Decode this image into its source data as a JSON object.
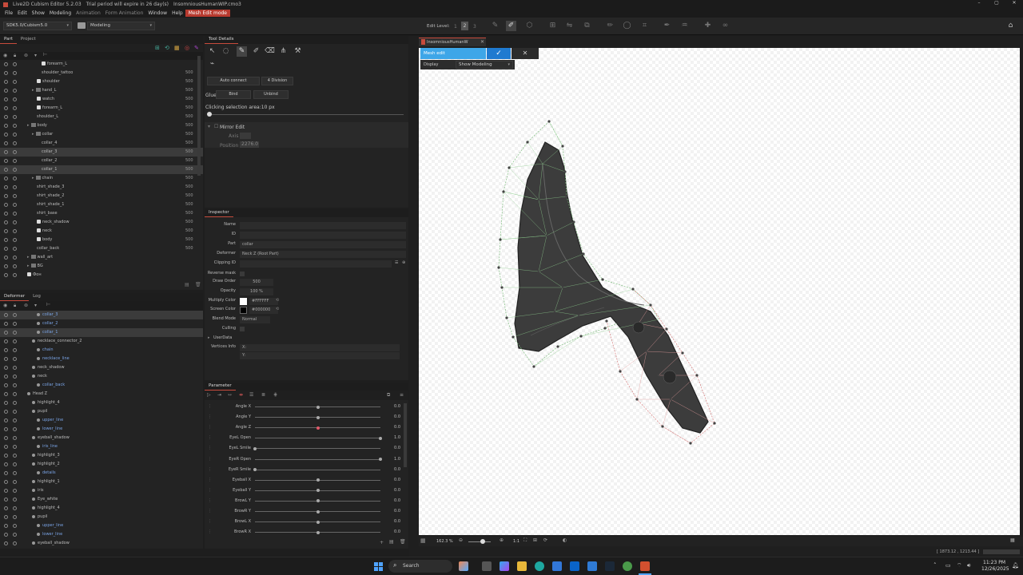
{
  "titlebar": {
    "app": "Live2D Cubism Editor 5.2.03",
    "trial": "Trial period will expire in 26 day(s)",
    "file": "InsomniousHumanWIP.cmo3"
  },
  "menu": [
    "File",
    "Edit",
    "Show",
    "Modeling",
    "Animation",
    "Form Animation",
    "Window",
    "Help"
  ],
  "menu_mode": "Mesh Edit mode",
  "toolbar": {
    "sdk": "SDK5.0/Cubism5.0",
    "workspace": "Modeling",
    "edit_level_label": "Edit Level:",
    "levels": [
      "1",
      "2",
      "3"
    ]
  },
  "part_panel": {
    "tabs": [
      "Part",
      "Project"
    ],
    "rows": [
      {
        "label": "forearm_L",
        "num": "",
        "indent": 52,
        "icon": "item"
      },
      {
        "label": "shoulder_tattoo",
        "num": "500",
        "indent": 52,
        "icon": "none"
      },
      {
        "label": "shoulder",
        "num": "500",
        "indent": 46,
        "icon": "item"
      },
      {
        "label": "hand_L",
        "num": "500",
        "indent": 40,
        "icon": "folder"
      },
      {
        "label": "watch",
        "num": "500",
        "indent": 46,
        "icon": "item"
      },
      {
        "label": "forearm_L",
        "num": "500",
        "indent": 46,
        "icon": "item"
      },
      {
        "label": "shoulder_L",
        "num": "500",
        "indent": 46,
        "icon": "none"
      },
      {
        "label": "body",
        "num": "500",
        "indent": 34,
        "icon": "folder"
      },
      {
        "label": "collar",
        "num": "500",
        "indent": 40,
        "icon": "folder"
      },
      {
        "label": "collar_4",
        "num": "500",
        "indent": 52,
        "icon": "none"
      },
      {
        "label": "collar_3",
        "num": "500",
        "indent": 52,
        "icon": "none",
        "sel": true
      },
      {
        "label": "collar_2",
        "num": "500",
        "indent": 52,
        "icon": "none"
      },
      {
        "label": "collar_1",
        "num": "500",
        "indent": 52,
        "icon": "none",
        "sel": true
      },
      {
        "label": "chain",
        "num": "500",
        "indent": 40,
        "icon": "folder"
      },
      {
        "label": "shirt_shade_3",
        "num": "500",
        "indent": 46,
        "icon": "none"
      },
      {
        "label": "shirt_shade_2",
        "num": "500",
        "indent": 46,
        "icon": "none"
      },
      {
        "label": "shirt_shade_1",
        "num": "500",
        "indent": 46,
        "icon": "none"
      },
      {
        "label": "shirt_base",
        "num": "500",
        "indent": 46,
        "icon": "none"
      },
      {
        "label": "neck_shadow",
        "num": "500",
        "indent": 46,
        "icon": "item"
      },
      {
        "label": "neck",
        "num": "500",
        "indent": 46,
        "icon": "item"
      },
      {
        "label": "body",
        "num": "500",
        "indent": 46,
        "icon": "item"
      },
      {
        "label": "collar_back",
        "num": "500",
        "indent": 46,
        "icon": "none"
      },
      {
        "label": "wall_art",
        "num": "",
        "indent": 34,
        "icon": "folder"
      },
      {
        "label": "BG",
        "num": "",
        "indent": 34,
        "icon": "folder"
      },
      {
        "label": "Фон",
        "num": "",
        "indent": 34,
        "icon": "item"
      }
    ]
  },
  "deformer_panel": {
    "tabs": [
      "Deformer",
      "Log"
    ],
    "rows": [
      {
        "label": "collar_3",
        "indent": 46,
        "sel": true
      },
      {
        "label": "collar_2",
        "indent": 46
      },
      {
        "label": "collar_1",
        "indent": 46,
        "sel": true
      },
      {
        "label": "necklace_connector_2",
        "indent": 40
      },
      {
        "label": "chain",
        "indent": 46
      },
      {
        "label": "necklace_line",
        "indent": 46
      },
      {
        "label": "neck_shadow",
        "indent": 40
      },
      {
        "label": "neck",
        "indent": 40
      },
      {
        "label": "collar_back",
        "indent": 46
      },
      {
        "label": "Head Z",
        "indent": 34
      },
      {
        "label": "highlight_4",
        "indent": 40
      },
      {
        "label": "pupil",
        "indent": 40
      },
      {
        "label": "upper_line",
        "indent": 46
      },
      {
        "label": "lower_line",
        "indent": 46
      },
      {
        "label": "eyeball_shadow",
        "indent": 40
      },
      {
        "label": "iris_line",
        "indent": 46
      },
      {
        "label": "highlight_3",
        "indent": 40
      },
      {
        "label": "highlight_2",
        "indent": 40
      },
      {
        "label": "details",
        "indent": 46
      },
      {
        "label": "highlight_1",
        "indent": 40
      },
      {
        "label": "iris",
        "indent": 40
      },
      {
        "label": "Eye_white",
        "indent": 40
      },
      {
        "label": "highlight_4",
        "indent": 40
      },
      {
        "label": "pupil",
        "indent": 40
      },
      {
        "label": "upper_line",
        "indent": 46
      },
      {
        "label": "lower_line",
        "indent": 46
      },
      {
        "label": "eyeball_shadow",
        "indent": 40
      }
    ]
  },
  "tool_details": {
    "title": "Tool Details",
    "auto_connect": "Auto connect",
    "division": "4 Division",
    "glue_label": "Glue:",
    "bind": "Bind",
    "unbind": "Unbind",
    "selection_area": "Clicking selection area:10 px",
    "mirror_edit": "Mirror Edit",
    "axis_label": "Axis",
    "position_label": "Position",
    "position_value": "2276.0"
  },
  "inspector": {
    "title": "Inspector",
    "name_label": "Name",
    "id_label": "ID",
    "part_label": "Part",
    "part_value": "collar",
    "deformer_label": "Deformer",
    "deformer_value": "Neck Z (Root Part)",
    "clipping_label": "Clipping ID",
    "reverse_mask_label": "Reverse mask",
    "draw_order_label": "Draw Order",
    "draw_order_value": "500",
    "opacity_label": "Opacity",
    "opacity_value": "100 %",
    "multiply_label": "Multiply Color",
    "multiply_value": "#FFFFFF",
    "screen_label": "Screen Color",
    "screen_value": "#000000",
    "blend_label": "Blend Mode",
    "blend_value": "Normal",
    "culling_label": "Culling",
    "userdata_label": "UserData",
    "vertices_label": "Vertices Info",
    "vx": "X:",
    "vy": "Y:"
  },
  "parameter": {
    "title": "Parameter",
    "items": [
      {
        "name": "Angle X",
        "value": "0.0",
        "pos": 0.5
      },
      {
        "name": "Angle Y",
        "value": "0.0",
        "pos": 0.5
      },
      {
        "name": "Angle Z",
        "value": "0.0",
        "pos": 0.5,
        "active": true
      },
      {
        "name": "EyeL Open",
        "value": "1.0",
        "pos": 1.0
      },
      {
        "name": "EyeL Smile",
        "value": "0.0",
        "pos": 0.0
      },
      {
        "name": "EyeR Open",
        "value": "1.0",
        "pos": 1.0
      },
      {
        "name": "EyeR Smile",
        "value": "0.0",
        "pos": 0.0
      },
      {
        "name": "Eyeball X",
        "value": "0.0",
        "pos": 0.5
      },
      {
        "name": "Eyeball Y",
        "value": "0.0",
        "pos": 0.5
      },
      {
        "name": "BrowL Y",
        "value": "0.0",
        "pos": 0.5
      },
      {
        "name": "BrowR Y",
        "value": "0.0",
        "pos": 0.5
      },
      {
        "name": "BrowL X",
        "value": "0.0",
        "pos": 0.5
      },
      {
        "name": "BrowR X",
        "value": "0.0",
        "pos": 0.5
      }
    ]
  },
  "viewer": {
    "tab": "InsomniousHumanW",
    "mesh_edit": "Mesh edit",
    "display_label": "Display",
    "display_value": "Show Modeling",
    "zoom": "162.3 %",
    "ratio": "1:1",
    "coords": "[ 1873.12 , 1213.44 ]"
  },
  "taskbar": {
    "search": "Search",
    "time": "11:23 PM",
    "date": "12/26/2025"
  }
}
